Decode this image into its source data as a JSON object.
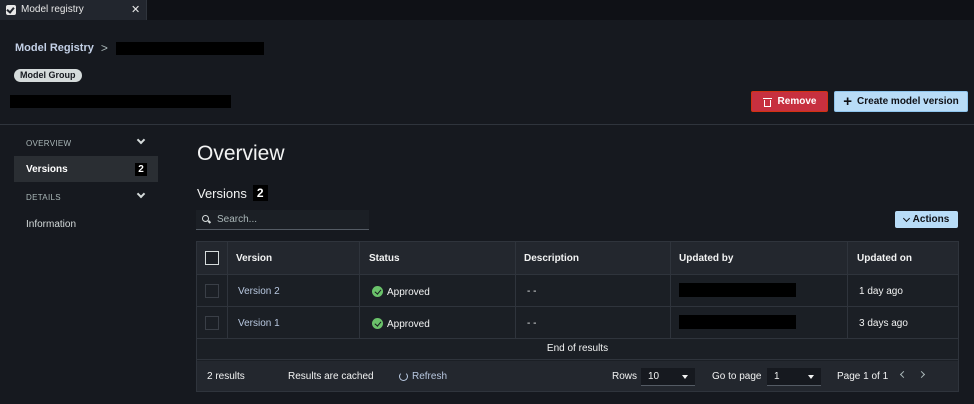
{
  "tab": {
    "title": "Model registry",
    "close": "✕"
  },
  "breadcrumb": {
    "root": "Model Registry",
    "separator": ">"
  },
  "badge": "Model Group",
  "buttons": {
    "remove": "Remove",
    "create": "Create model version",
    "actions": "Actions"
  },
  "sidebar": {
    "overview": "OVERVIEW",
    "versions": {
      "label": "Versions",
      "count": "2"
    },
    "details": "DETAILS",
    "information": "Information"
  },
  "main": {
    "title": "Overview",
    "section": {
      "label": "Versions",
      "count": "2"
    },
    "search_placeholder": "Search..."
  },
  "table": {
    "headers": [
      "Version",
      "Status",
      "Description",
      "Updated by",
      "Updated on"
    ],
    "rows": [
      {
        "version": "Version 2",
        "status": "Approved",
        "description": "- -",
        "updated_on": "1 day ago"
      },
      {
        "version": "Version 1",
        "status": "Approved",
        "description": "- -",
        "updated_on": "3 days ago"
      }
    ],
    "end": "End of results"
  },
  "footer": {
    "results": "2 results",
    "cached": "Results are cached",
    "refresh": "Refresh",
    "rows_label": "Rows",
    "rows_value": "10",
    "goto_label": "Go to page",
    "goto_value": "1",
    "page_of": "Page 1 of 1"
  },
  "colors": {
    "accent": "#b8dcf7",
    "danger": "#c7303f",
    "success": "#6ac26a",
    "background": "#16191f"
  },
  "icons": [
    "check-icon",
    "close-icon",
    "chevron-right-icon",
    "trash-icon",
    "plus-icon",
    "chevron-down-icon",
    "search-icon",
    "success-icon",
    "refresh-icon",
    "chevron-left-icon"
  ]
}
